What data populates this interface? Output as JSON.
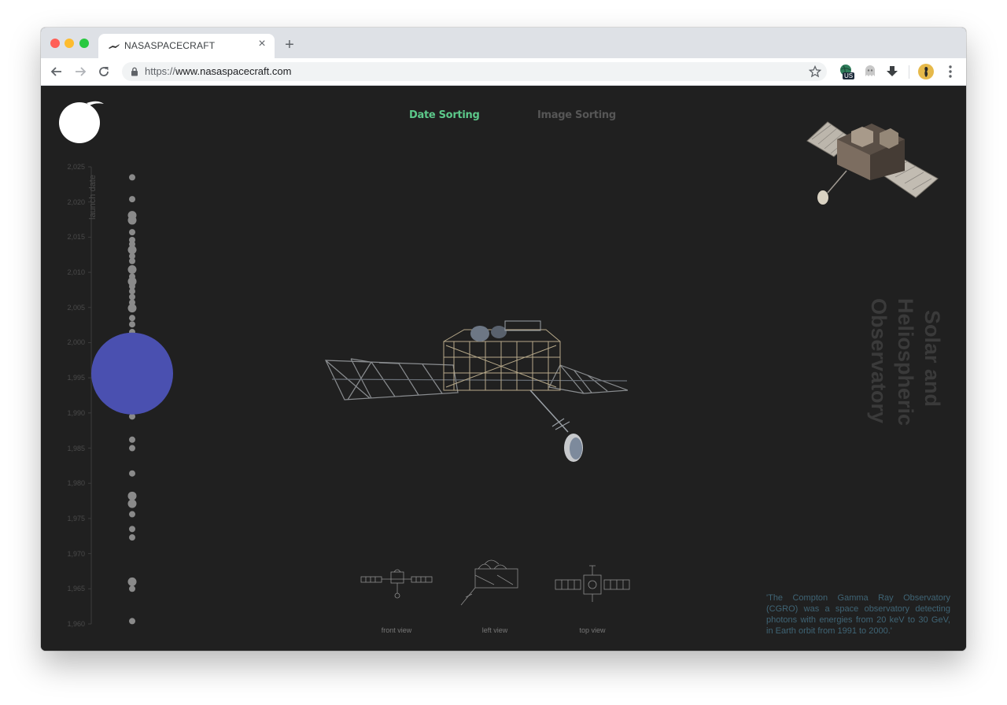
{
  "browser": {
    "tab_title": "NASASPACECRAFT",
    "tab_close": "×",
    "new_tab": "+",
    "url_scheme": "https://",
    "url_host": "www.nasaspacecraft.com",
    "extension_badge": "US"
  },
  "nav": {
    "date_sorting": "Date Sorting",
    "image_sorting": "Image Sorting",
    "active_color": "#5cc98a",
    "inactive_color": "#565656"
  },
  "timeline": {
    "axis_title": "launch date",
    "ticks": [
      "2,025",
      "2,020",
      "2,015",
      "2,010",
      "2,005",
      "2,000",
      "1,995",
      "1,990",
      "1,985",
      "1,980",
      "1,975",
      "1,970",
      "1,965",
      "1,960"
    ],
    "dot_color": "#8a8a8a",
    "selected_color": "#4a50b0",
    "launch_years": [
      2023.5,
      2020.4,
      2018.1,
      2017.4,
      2015.7,
      2014.6,
      2014.0,
      2013.2,
      2012.3,
      2011.6,
      2010.4,
      2009.4,
      2008.7,
      2008.0,
      2007.3,
      2006.5,
      2005.7,
      2004.9,
      2003.5,
      2002.6,
      2001.5,
      2000.6,
      1999.7,
      1998.9,
      1998.0,
      1997.3,
      1996.4,
      1995.6,
      1994.8,
      1993.7,
      1992.6,
      1991.4,
      1990.4,
      1989.5,
      1986.2,
      1985.0,
      1981.4,
      1978.2,
      1977.1,
      1975.6,
      1973.5,
      1972.3,
      1966.0,
      1965.0,
      1960.4
    ],
    "selected_year": 1995.6
  },
  "spacecraft": {
    "title_lines": [
      "Solar and",
      "Heliospheric",
      "Observatory"
    ],
    "description": "'The Compton Gamma Ray Observatory (CGRO) was a space observatory detecting photons with energies from 20 keV to 30 GeV, in Earth orbit from 1991 to 2000.'"
  },
  "views": {
    "front": "front view",
    "left": "left view",
    "top": "top view"
  },
  "icons": {
    "back": "arrow-left-icon",
    "forward": "arrow-right-icon",
    "reload": "reload-icon",
    "lock": "lock-icon",
    "star": "star-icon",
    "menu": "kebab-menu-icon"
  }
}
